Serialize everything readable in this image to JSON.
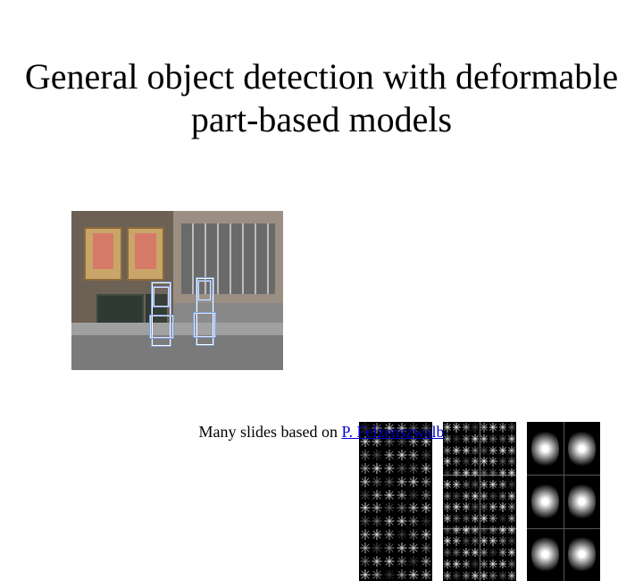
{
  "title": "General object detection with deformable part-based models",
  "credit": {
    "prefix": "Many slides based on ",
    "link_text": "P. Felzenszwalb"
  },
  "figures": {
    "scene": "street-scene-with-person-detections",
    "filters": [
      "root-hog-filter",
      "parts-hog-filters",
      "spatial-deformation-model"
    ]
  }
}
